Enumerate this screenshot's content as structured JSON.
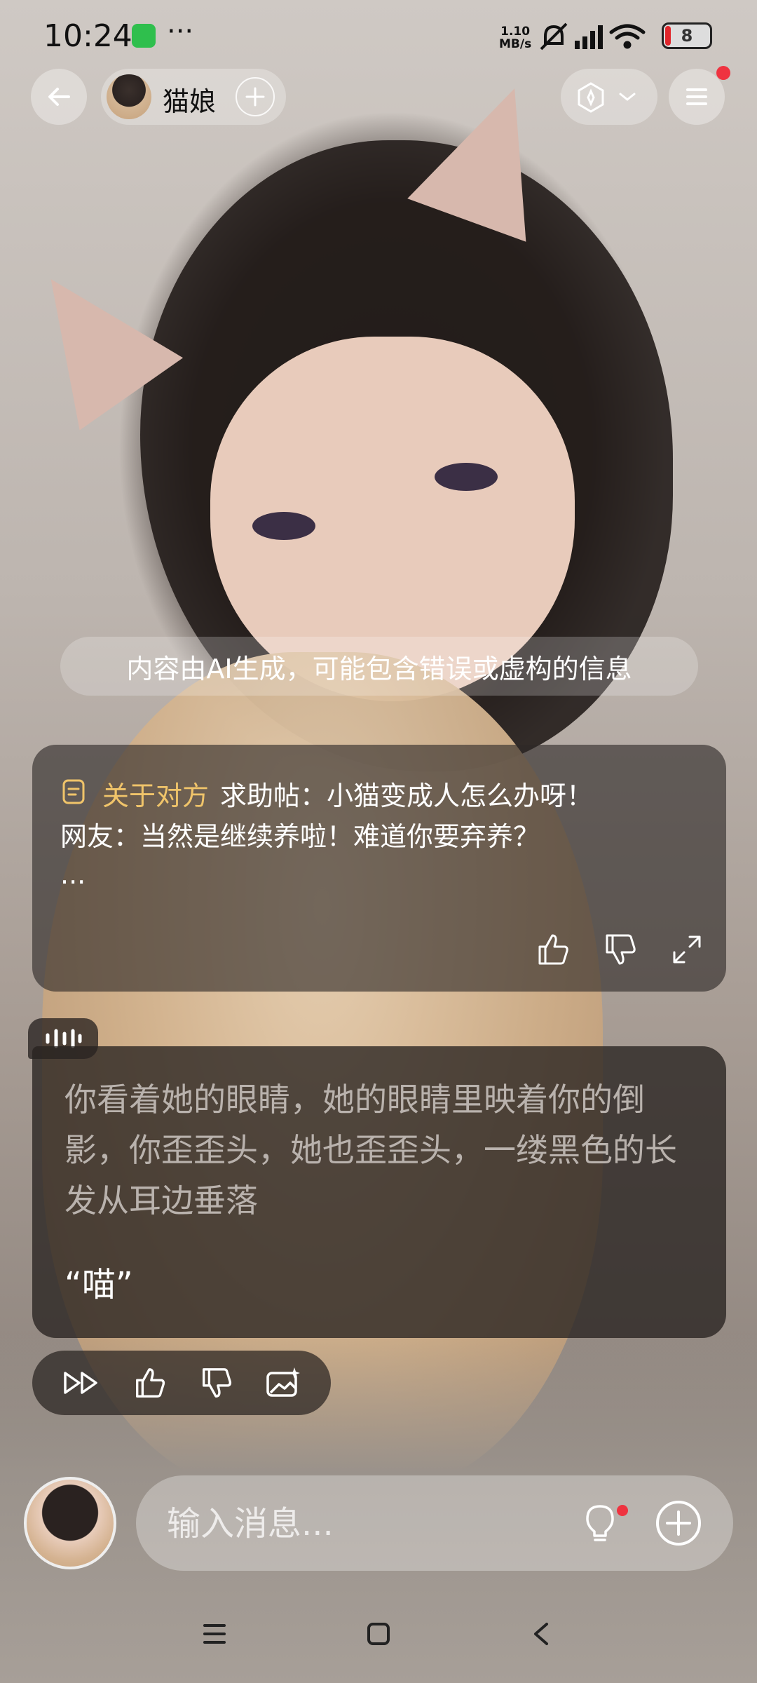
{
  "status_bar": {
    "time": "10:24",
    "net_speed_value": "1.10",
    "net_speed_unit": "MB/s",
    "battery": "8",
    "icons": [
      "app-notification-icon",
      "more-dots-icon",
      "mute-icon",
      "signal-icon",
      "wifi-icon",
      "battery-icon"
    ]
  },
  "header": {
    "character_name": "猫娘",
    "icons": [
      "back-arrow-icon",
      "add-icon",
      "model-icon",
      "chevron-down-icon",
      "menu-icon"
    ]
  },
  "disclaimer": "内容由AI生成，可能包含错误或虚构的信息",
  "about_card": {
    "tag": "关于对方",
    "line1": "求助帖：小猫变成人怎么办呀！",
    "line2": "网友：当然是继续养啦！难道你要弃养？",
    "line3": "...",
    "icons": [
      "document-icon",
      "thumbs-up-icon",
      "thumbs-down-icon",
      "expand-icon"
    ]
  },
  "message": {
    "narration": "你看着她的眼睛，她的眼睛里映着你的倒影，你歪歪头，她也歪歪头，一缕黑色的长发从耳边垂落",
    "speech": "“喵”",
    "icons": [
      "voice-wave-icon"
    ]
  },
  "action_bar": {
    "icons": [
      "fast-forward-icon",
      "thumbs-up-icon",
      "thumbs-down-icon",
      "image-sparkle-icon"
    ]
  },
  "composer": {
    "placeholder": "输入消息...",
    "icons": [
      "user-avatar",
      "lightbulb-icon",
      "plus-circle-icon"
    ]
  },
  "nav_bar": {
    "icons": [
      "recents-icon",
      "home-icon",
      "back-icon"
    ]
  }
}
